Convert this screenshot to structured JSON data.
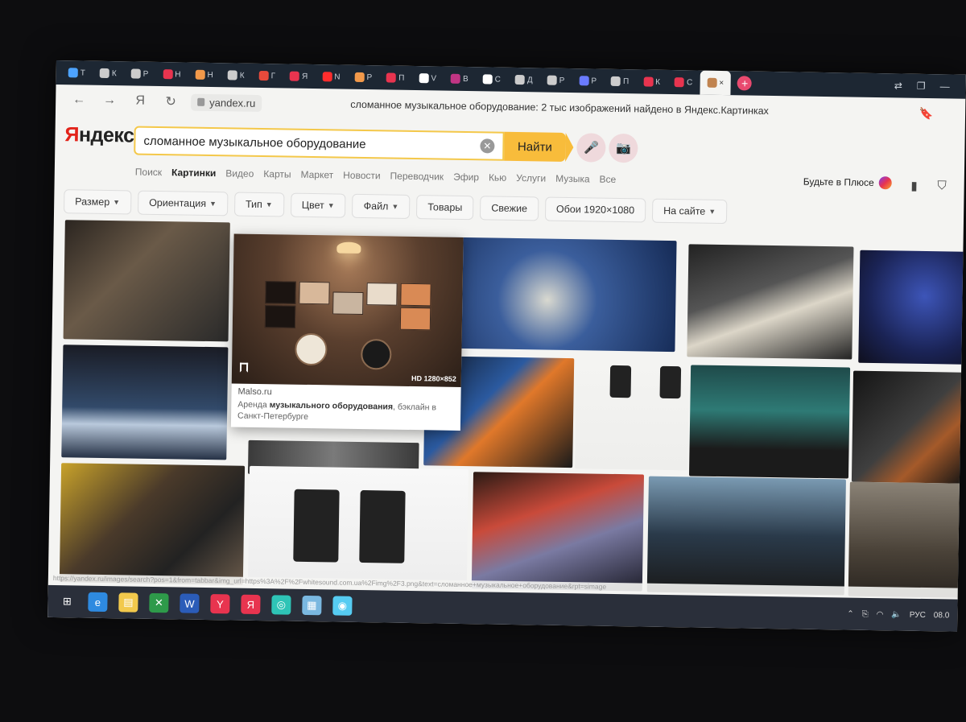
{
  "tabs": [
    {
      "label": "Т",
      "color": "#4da3ff"
    },
    {
      "label": "К",
      "color": "#cccccc"
    },
    {
      "label": "Р",
      "color": "#cccccc"
    },
    {
      "label": "Н",
      "color": "#e8344f"
    },
    {
      "label": "Н",
      "color": "#f2994a"
    },
    {
      "label": "К",
      "color": "#cccccc"
    },
    {
      "label": "Г",
      "color": "#e84a3b"
    },
    {
      "label": "Я",
      "color": "#e8344f"
    },
    {
      "label": "N",
      "color": "#ff2d2d"
    },
    {
      "label": "Р",
      "color": "#f2994a"
    },
    {
      "label": "П",
      "color": "#e8344f"
    },
    {
      "label": "V",
      "color": "#ffffff"
    },
    {
      "label": "В",
      "color": "#c13584"
    },
    {
      "label": "С",
      "color": "#ffffff"
    },
    {
      "label": "Д",
      "color": "#cccccc"
    },
    {
      "label": "Р",
      "color": "#cccccc"
    },
    {
      "label": "Р",
      "color": "#6a7bff"
    },
    {
      "label": "П",
      "color": "#cccccc"
    },
    {
      "label": "К",
      "color": "#e8344f"
    },
    {
      "label": "С",
      "color": "#e8344f"
    }
  ],
  "active_tab": {
    "close": "×"
  },
  "tab_add": "+",
  "address": {
    "url": "yandex.ru",
    "title": "сломанное музыкальное оборудование: 2 тыс изображений найдено в Яндекс.Картинках"
  },
  "logo": {
    "first": "Я",
    "rest": "ндекс"
  },
  "search": {
    "query": "сломанное музыкальное оборудование",
    "button": "Найти"
  },
  "services": [
    "Поиск",
    "Картинки",
    "Видео",
    "Карты",
    "Маркет",
    "Новости",
    "Переводчик",
    "Эфир",
    "Кью",
    "Услуги",
    "Музыка",
    "Все"
  ],
  "active_service": "Картинки",
  "plus_label": "Будьте в Плюсе",
  "filters": [
    {
      "label": "Размер",
      "dropdown": true
    },
    {
      "label": "Ориентация",
      "dropdown": true
    },
    {
      "label": "Тип",
      "dropdown": true
    },
    {
      "label": "Цвет",
      "dropdown": true
    },
    {
      "label": "Файл",
      "dropdown": true
    },
    {
      "label": "Товары",
      "dropdown": false
    },
    {
      "label": "Свежие",
      "dropdown": false
    },
    {
      "label": "Обои 1920×1080",
      "dropdown": false
    },
    {
      "label": "На сайте",
      "dropdown": true
    }
  ],
  "popup": {
    "resolution": "HD 1280×852",
    "source": "Malso.ru",
    "desc_before": "Аренда ",
    "desc_bold": "музыкального оборудования",
    "desc_after": ", бэклайн в Санкт-Петербурге"
  },
  "status_url": "https://yandex.ru/images/search?pos=1&from=tabbar&img_url=https%3A%2F%2Fwhitesound.com.ua%2Fimg%2F3.png&text=сломанное+музыкальное+оборудование&rpt=simage",
  "taskbar": [
    "windows-icon",
    "edge-icon",
    "explorer-icon",
    "excel-icon",
    "word-icon",
    "yandex-browser-icon",
    "yandex-icon",
    "app-icon",
    "notes-icon",
    "maps-icon"
  ],
  "tray": {
    "lang": "РУС",
    "date": "08.0"
  }
}
